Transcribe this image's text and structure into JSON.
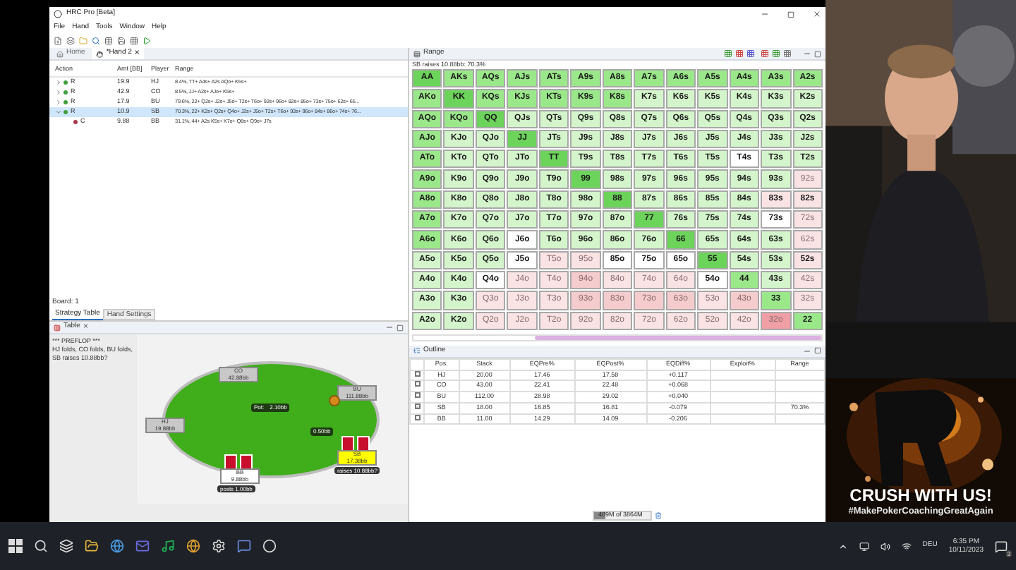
{
  "window": {
    "title": "HRC Pro [Beta]"
  },
  "menu": [
    "File",
    "Hand",
    "Tools",
    "Window",
    "Help"
  ],
  "editor_tabs": [
    {
      "label": "Home",
      "selected": false
    },
    {
      "label": "*Hand 2",
      "selected": true,
      "close": "×"
    }
  ],
  "actions": {
    "columns": [
      "Action",
      "Amt [BB]",
      "Player",
      "Range"
    ],
    "rows": [
      {
        "action": "R",
        "amount": "19.9",
        "player": "HJ",
        "range": "8.4%, TT+ A4s+ A2s AQo+ K5s+",
        "color": "#3f9f3f",
        "expanded": false,
        "selected": false
      },
      {
        "action": "R",
        "amount": "42.9",
        "player": "CO",
        "range": "8.5%, JJ+ A2s+ AJo+ K5s+",
        "color": "#3f9f3f",
        "expanded": false,
        "selected": false
      },
      {
        "action": "R",
        "amount": "17.9",
        "player": "BU",
        "range": "79.6%, 22+ Q2s+ J2s+ J5o+ T2s+ T6o+ 92s+ 96o+ 82s+ 85o+ 73s+ 75o+ 62s+ 65...",
        "color": "#3f9f3f",
        "expanded": false,
        "selected": false
      },
      {
        "action": "R",
        "amount": "10.9",
        "player": "SB",
        "range": "70.3%, 22+ K2s+ Q2s+ Q4o+ J2s+ J5o+ T2s+ T6o+ 93s+ 96o+ 84s+ 86o+ 74s+ 76...",
        "color": "#3f9f3f",
        "expanded": true,
        "selected": true,
        "children": [
          {
            "action": "C",
            "amount": "9.88",
            "player": "BB",
            "range": "31.1%, 44+ A2s K5s+ K7o+ Q8s+ Q9o+ J7s",
            "color": "#a83a4a"
          }
        ]
      }
    ]
  },
  "board": "Board: 1",
  "bottom_tabs": [
    {
      "label": "Strategy Table",
      "selected": true
    },
    {
      "label": "Hand Settings",
      "selected": false
    }
  ],
  "table_panel": {
    "title": "Table",
    "close": "×",
    "log": [
      "*** PREFLOP ***",
      "HJ folds, CO folds, BU folds, SB raises 10.88bb?"
    ],
    "pot_label": "Pot:",
    "pot": "2.10bb",
    "bet": "0.50bb",
    "seats": [
      {
        "position": "CO",
        "stack": "42.88bb",
        "active": false,
        "cards": false,
        "dealer": false
      },
      {
        "position": "BU",
        "stack": "111.88bb",
        "active": false,
        "cards": false,
        "dealer": true
      },
      {
        "position": "HJ",
        "stack": "19.88bb",
        "active": false,
        "cards": false,
        "dealer": false
      },
      {
        "position": "SB",
        "stack": "17.38bb",
        "active": true,
        "cards": true,
        "dealer": false,
        "action": "raises 10.88bb?"
      },
      {
        "position": "BB",
        "stack": "9.88bb",
        "active": false,
        "cards": true,
        "dealer": false,
        "action": "posts 1.00bb"
      }
    ]
  },
  "range": {
    "title": "Range",
    "summary": "SB raises 10.88bb: 70.3%",
    "level": 0.703,
    "rows": [
      [
        {
          "hand": "AA",
          "color": "#6cd35b",
          "folded": false
        },
        {
          "hand": "AKs",
          "color": "#9be88a",
          "folded": false
        },
        {
          "hand": "AQs",
          "color": "#9be88a",
          "folded": false
        },
        {
          "hand": "AJs",
          "color": "#9be88a",
          "folded": false
        },
        {
          "hand": "ATs",
          "color": "#9be88a",
          "folded": false
        },
        {
          "hand": "A9s",
          "color": "#9be88a",
          "folded": false
        },
        {
          "hand": "A8s",
          "color": "#9be88a",
          "folded": false
        },
        {
          "hand": "A7s",
          "color": "#9be88a",
          "folded": false
        },
        {
          "hand": "A6s",
          "color": "#9be88a",
          "folded": false
        },
        {
          "hand": "A5s",
          "color": "#9be88a",
          "folded": false
        },
        {
          "hand": "A4s",
          "color": "#9be88a",
          "folded": false
        },
        {
          "hand": "A3s",
          "color": "#9be88a",
          "folded": false
        },
        {
          "hand": "A2s",
          "color": "#9be88a",
          "folded": false
        }
      ],
      [
        {
          "hand": "AKo",
          "color": "#9be88a",
          "folded": false
        },
        {
          "hand": "KK",
          "color": "#6cd35b",
          "folded": false
        },
        {
          "hand": "KQs",
          "color": "#9be88a",
          "folded": false
        },
        {
          "hand": "KJs",
          "color": "#9be88a",
          "folded": false
        },
        {
          "hand": "KTs",
          "color": "#9be88a",
          "folded": false
        },
        {
          "hand": "K9s",
          "color": "#9be88a",
          "folded": false
        },
        {
          "hand": "K8s",
          "color": "#9be88a",
          "folded": false
        },
        {
          "hand": "K7s",
          "color": "#d4f5cb",
          "folded": false
        },
        {
          "hand": "K6s",
          "color": "#d4f5cb",
          "folded": false
        },
        {
          "hand": "K5s",
          "color": "#d4f5cb",
          "folded": false
        },
        {
          "hand": "K4s",
          "color": "#d4f5cb",
          "folded": false
        },
        {
          "hand": "K3s",
          "color": "#d4f5cb",
          "folded": false
        },
        {
          "hand": "K2s",
          "color": "#d4f5cb",
          "folded": false
        }
      ],
      [
        {
          "hand": "AQo",
          "color": "#9be88a",
          "folded": false
        },
        {
          "hand": "KQo",
          "color": "#9be88a",
          "folded": false
        },
        {
          "hand": "QQ",
          "color": "#6cd35b",
          "folded": false
        },
        {
          "hand": "QJs",
          "color": "#d4f5cb",
          "folded": false
        },
        {
          "hand": "QTs",
          "color": "#d4f5cb",
          "folded": false
        },
        {
          "hand": "Q9s",
          "color": "#d4f5cb",
          "folded": false
        },
        {
          "hand": "Q8s",
          "color": "#d4f5cb",
          "folded": false
        },
        {
          "hand": "Q7s",
          "color": "#d4f5cb",
          "folded": false
        },
        {
          "hand": "Q6s",
          "color": "#d4f5cb",
          "folded": false
        },
        {
          "hand": "Q5s",
          "color": "#d4f5cb",
          "folded": false
        },
        {
          "hand": "Q4s",
          "color": "#d4f5cb",
          "folded": false
        },
        {
          "hand": "Q3s",
          "color": "#d4f5cb",
          "folded": false
        },
        {
          "hand": "Q2s",
          "color": "#d4f5cb",
          "folded": false
        }
      ],
      [
        {
          "hand": "AJo",
          "color": "#9be88a",
          "folded": false
        },
        {
          "hand": "KJo",
          "color": "#d4f5cb",
          "folded": false
        },
        {
          "hand": "QJo",
          "color": "#d4f5cb",
          "folded": false
        },
        {
          "hand": "JJ",
          "color": "#6cd35b",
          "folded": false
        },
        {
          "hand": "JTs",
          "color": "#d4f5cb",
          "folded": false
        },
        {
          "hand": "J9s",
          "color": "#d4f5cb",
          "folded": false
        },
        {
          "hand": "J8s",
          "color": "#d4f5cb",
          "folded": false
        },
        {
          "hand": "J7s",
          "color": "#d4f5cb",
          "folded": false
        },
        {
          "hand": "J6s",
          "color": "#d4f5cb",
          "folded": false
        },
        {
          "hand": "J5s",
          "color": "#d4f5cb",
          "folded": false
        },
        {
          "hand": "J4s",
          "color": "#d4f5cb",
          "folded": false
        },
        {
          "hand": "J3s",
          "color": "#d4f5cb",
          "folded": false
        },
        {
          "hand": "J2s",
          "color": "#d4f5cb",
          "folded": false
        }
      ],
      [
        {
          "hand": "ATo",
          "color": "#9be88a",
          "folded": false
        },
        {
          "hand": "KTo",
          "color": "#d4f5cb",
          "folded": false
        },
        {
          "hand": "QTo",
          "color": "#d4f5cb",
          "folded": false
        },
        {
          "hand": "JTo",
          "color": "#d4f5cb",
          "folded": false
        },
        {
          "hand": "TT",
          "color": "#6cd35b",
          "folded": false
        },
        {
          "hand": "T9s",
          "color": "#d4f5cb",
          "folded": false
        },
        {
          "hand": "T8s",
          "color": "#d4f5cb",
          "folded": false
        },
        {
          "hand": "T7s",
          "color": "#d4f5cb",
          "folded": false
        },
        {
          "hand": "T6s",
          "color": "#d4f5cb",
          "folded": false
        },
        {
          "hand": "T5s",
          "color": "#d4f5cb",
          "folded": false
        },
        {
          "hand": "T4s",
          "color": "#ffffff",
          "folded": false
        },
        {
          "hand": "T3s",
          "color": "#d4f5cb",
          "folded": false
        },
        {
          "hand": "T2s",
          "color": "#d4f5cb",
          "folded": false
        }
      ],
      [
        {
          "hand": "A9o",
          "color": "#9be88a",
          "folded": false
        },
        {
          "hand": "K9o",
          "color": "#d4f5cb",
          "folded": false
        },
        {
          "hand": "Q9o",
          "color": "#d4f5cb",
          "folded": false
        },
        {
          "hand": "J9o",
          "color": "#d4f5cb",
          "folded": false
        },
        {
          "hand": "T9o",
          "color": "#d4f5cb",
          "folded": false
        },
        {
          "hand": "99",
          "color": "#6cd35b",
          "folded": false
        },
        {
          "hand": "98s",
          "color": "#d4f5cb",
          "folded": false
        },
        {
          "hand": "97s",
          "color": "#d4f5cb",
          "folded": false
        },
        {
          "hand": "96s",
          "color": "#d4f5cb",
          "folded": false
        },
        {
          "hand": "95s",
          "color": "#d4f5cb",
          "folded": false
        },
        {
          "hand": "94s",
          "color": "#d4f5cb",
          "folded": false
        },
        {
          "hand": "93s",
          "color": "#d4f5cb",
          "folded": false
        },
        {
          "hand": "92s",
          "color": "#fae3e4",
          "folded": true
        }
      ],
      [
        {
          "hand": "A8o",
          "color": "#9be88a",
          "folded": false
        },
        {
          "hand": "K8o",
          "color": "#d4f5cb",
          "folded": false
        },
        {
          "hand": "Q8o",
          "color": "#d4f5cb",
          "folded": false
        },
        {
          "hand": "J8o",
          "color": "#d4f5cb",
          "folded": false
        },
        {
          "hand": "T8o",
          "color": "#d4f5cb",
          "folded": false
        },
        {
          "hand": "98o",
          "color": "#d4f5cb",
          "folded": false
        },
        {
          "hand": "88",
          "color": "#6cd35b",
          "folded": false
        },
        {
          "hand": "87s",
          "color": "#d4f5cb",
          "folded": false
        },
        {
          "hand": "86s",
          "color": "#d4f5cb",
          "folded": false
        },
        {
          "hand": "85s",
          "color": "#d4f5cb",
          "folded": false
        },
        {
          "hand": "84s",
          "color": "#d4f5cb",
          "folded": false
        },
        {
          "hand": "83s",
          "color": "#fae3e4",
          "folded": false
        },
        {
          "hand": "82s",
          "color": "#fae3e4",
          "folded": false
        }
      ],
      [
        {
          "hand": "A7o",
          "color": "#9be88a",
          "folded": false
        },
        {
          "hand": "K7o",
          "color": "#d4f5cb",
          "folded": false
        },
        {
          "hand": "Q7o",
          "color": "#d4f5cb",
          "folded": false
        },
        {
          "hand": "J7o",
          "color": "#d4f5cb",
          "folded": false
        },
        {
          "hand": "T7o",
          "color": "#d4f5cb",
          "folded": false
        },
        {
          "hand": "97o",
          "color": "#d4f5cb",
          "folded": false
        },
        {
          "hand": "87o",
          "color": "#d4f5cb",
          "folded": false
        },
        {
          "hand": "77",
          "color": "#6cd35b",
          "folded": false
        },
        {
          "hand": "76s",
          "color": "#d4f5cb",
          "folded": false
        },
        {
          "hand": "75s",
          "color": "#d4f5cb",
          "folded": false
        },
        {
          "hand": "74s",
          "color": "#d4f5cb",
          "folded": false
        },
        {
          "hand": "73s",
          "color": "#ffffff",
          "folded": false
        },
        {
          "hand": "72s",
          "color": "#fae3e4",
          "folded": true
        }
      ],
      [
        {
          "hand": "A6o",
          "color": "#9be88a",
          "folded": false
        },
        {
          "hand": "K6o",
          "color": "#d4f5cb",
          "folded": false
        },
        {
          "hand": "Q6o",
          "color": "#d4f5cb",
          "folded": false
        },
        {
          "hand": "J6o",
          "color": "#ffffff",
          "folded": false
        },
        {
          "hand": "T6o",
          "color": "#d4f5cb",
          "folded": false
        },
        {
          "hand": "96o",
          "color": "#d4f5cb",
          "folded": false
        },
        {
          "hand": "86o",
          "color": "#d4f5cb",
          "folded": false
        },
        {
          "hand": "76o",
          "color": "#d4f5cb",
          "folded": false
        },
        {
          "hand": "66",
          "color": "#6cd35b",
          "folded": false
        },
        {
          "hand": "65s",
          "color": "#d4f5cb",
          "folded": false
        },
        {
          "hand": "64s",
          "color": "#d4f5cb",
          "folded": false
        },
        {
          "hand": "63s",
          "color": "#d4f5cb",
          "folded": false
        },
        {
          "hand": "62s",
          "color": "#fae3e4",
          "folded": true
        }
      ],
      [
        {
          "hand": "A5o",
          "color": "#d4f5cb",
          "folded": false
        },
        {
          "hand": "K5o",
          "color": "#d4f5cb",
          "folded": false
        },
        {
          "hand": "Q5o",
          "color": "#d4f5cb",
          "folded": false
        },
        {
          "hand": "J5o",
          "color": "#ffffff",
          "folded": false
        },
        {
          "hand": "T5o",
          "color": "#fae3e4",
          "folded": true
        },
        {
          "hand": "95o",
          "color": "#fae3e4",
          "folded": true
        },
        {
          "hand": "85o",
          "color": "#ffffff",
          "folded": false
        },
        {
          "hand": "75o",
          "color": "#ffffff",
          "folded": false
        },
        {
          "hand": "65o",
          "color": "#ffffff",
          "folded": false
        },
        {
          "hand": "55",
          "color": "#6cd35b",
          "folded": false
        },
        {
          "hand": "54s",
          "color": "#d4f5cb",
          "folded": false
        },
        {
          "hand": "53s",
          "color": "#d4f5cb",
          "folded": false
        },
        {
          "hand": "52s",
          "color": "#fae3e4",
          "folded": false
        }
      ],
      [
        {
          "hand": "A4o",
          "color": "#d4f5cb",
          "folded": false
        },
        {
          "hand": "K4o",
          "color": "#d4f5cb",
          "folded": false
        },
        {
          "hand": "Q4o",
          "color": "#ffffff",
          "folded": false
        },
        {
          "hand": "J4o",
          "color": "#fae3e4",
          "folded": true
        },
        {
          "hand": "T4o",
          "color": "#fae3e4",
          "folded": true
        },
        {
          "hand": "94o",
          "color": "#f5ccce",
          "folded": true
        },
        {
          "hand": "84o",
          "color": "#fae3e4",
          "folded": true
        },
        {
          "hand": "74o",
          "color": "#fae3e4",
          "folded": true
        },
        {
          "hand": "64o",
          "color": "#fae3e4",
          "folded": true
        },
        {
          "hand": "54o",
          "color": "#ffffff",
          "folded": false
        },
        {
          "hand": "44",
          "color": "#9be88a",
          "folded": false
        },
        {
          "hand": "43s",
          "color": "#d4f5cb",
          "folded": false
        },
        {
          "hand": "42s",
          "color": "#fae3e4",
          "folded": true
        }
      ],
      [
        {
          "hand": "A3o",
          "color": "#d4f5cb",
          "folded": false
        },
        {
          "hand": "K3o",
          "color": "#d4f5cb",
          "folded": false
        },
        {
          "hand": "Q3o",
          "color": "#fae3e4",
          "folded": true
        },
        {
          "hand": "J3o",
          "color": "#fae3e4",
          "folded": true
        },
        {
          "hand": "T3o",
          "color": "#fae3e4",
          "folded": true
        },
        {
          "hand": "93o",
          "color": "#f5ccce",
          "folded": true
        },
        {
          "hand": "83o",
          "color": "#f5ccce",
          "folded": true
        },
        {
          "hand": "73o",
          "color": "#f5ccce",
          "folded": true
        },
        {
          "hand": "63o",
          "color": "#f5ccce",
          "folded": true
        },
        {
          "hand": "53o",
          "color": "#fae3e4",
          "folded": true
        },
        {
          "hand": "43o",
          "color": "#f5ccce",
          "folded": true
        },
        {
          "hand": "33",
          "color": "#9be88a",
          "folded": false
        },
        {
          "hand": "32s",
          "color": "#fae3e4",
          "folded": true
        }
      ],
      [
        {
          "hand": "A2o",
          "color": "#d4f5cb",
          "folded": false
        },
        {
          "hand": "K2o",
          "color": "#d4f5cb",
          "folded": false
        },
        {
          "hand": "Q2o",
          "color": "#fae3e4",
          "folded": true
        },
        {
          "hand": "J2o",
          "color": "#fae3e4",
          "folded": true
        },
        {
          "hand": "T2o",
          "color": "#fae3e4",
          "folded": true
        },
        {
          "hand": "92o",
          "color": "#fae3e4",
          "folded": true
        },
        {
          "hand": "82o",
          "color": "#fae3e4",
          "folded": true
        },
        {
          "hand": "72o",
          "color": "#fae3e4",
          "folded": true
        },
        {
          "hand": "62o",
          "color": "#fae3e4",
          "folded": true
        },
        {
          "hand": "52o",
          "color": "#fae3e4",
          "folded": true
        },
        {
          "hand": "42o",
          "color": "#fae3e4",
          "folded": true
        },
        {
          "hand": "32o",
          "color": "#ef9fa5",
          "folded": true
        },
        {
          "hand": "22",
          "color": "#9be88a",
          "folded": false
        }
      ]
    ]
  },
  "outline": {
    "title": "Outline",
    "columns": [
      "Pos.",
      "Stack",
      "EQPre%",
      "EQPost%",
      "EQDiff%",
      "Exploit%",
      "Range"
    ],
    "rows": [
      {
        "checked": false,
        "cells": [
          "HJ",
          "20.00",
          "17.46",
          "17.58",
          "+0.117",
          "",
          ""
        ]
      },
      {
        "checked": false,
        "cells": [
          "CO",
          "43.00",
          "22.41",
          "22.48",
          "+0.068",
          "",
          ""
        ]
      },
      {
        "checked": false,
        "cells": [
          "BU",
          "112.00",
          "28.98",
          "29.02",
          "+0.040",
          "",
          ""
        ]
      },
      {
        "checked": true,
        "cells": [
          "SB",
          "18.00",
          "16.85",
          "16.81",
          "-0.079",
          "",
          "70.3%"
        ]
      },
      {
        "checked": false,
        "cells": [
          "BB",
          "11.00",
          "14.29",
          "14.09",
          "-0.206",
          "",
          ""
        ]
      }
    ]
  },
  "status": {
    "memory": "409M of 3864M",
    "level": 0.2
  },
  "overlay": {
    "slogan": "CRUSH WITH US!",
    "hashtag": "#MakePokerCoachingGreatAgain"
  },
  "taskbar": {
    "language": "DEU",
    "time": "6:35 PM",
    "date": "10/11/2023",
    "notifications": "3"
  }
}
